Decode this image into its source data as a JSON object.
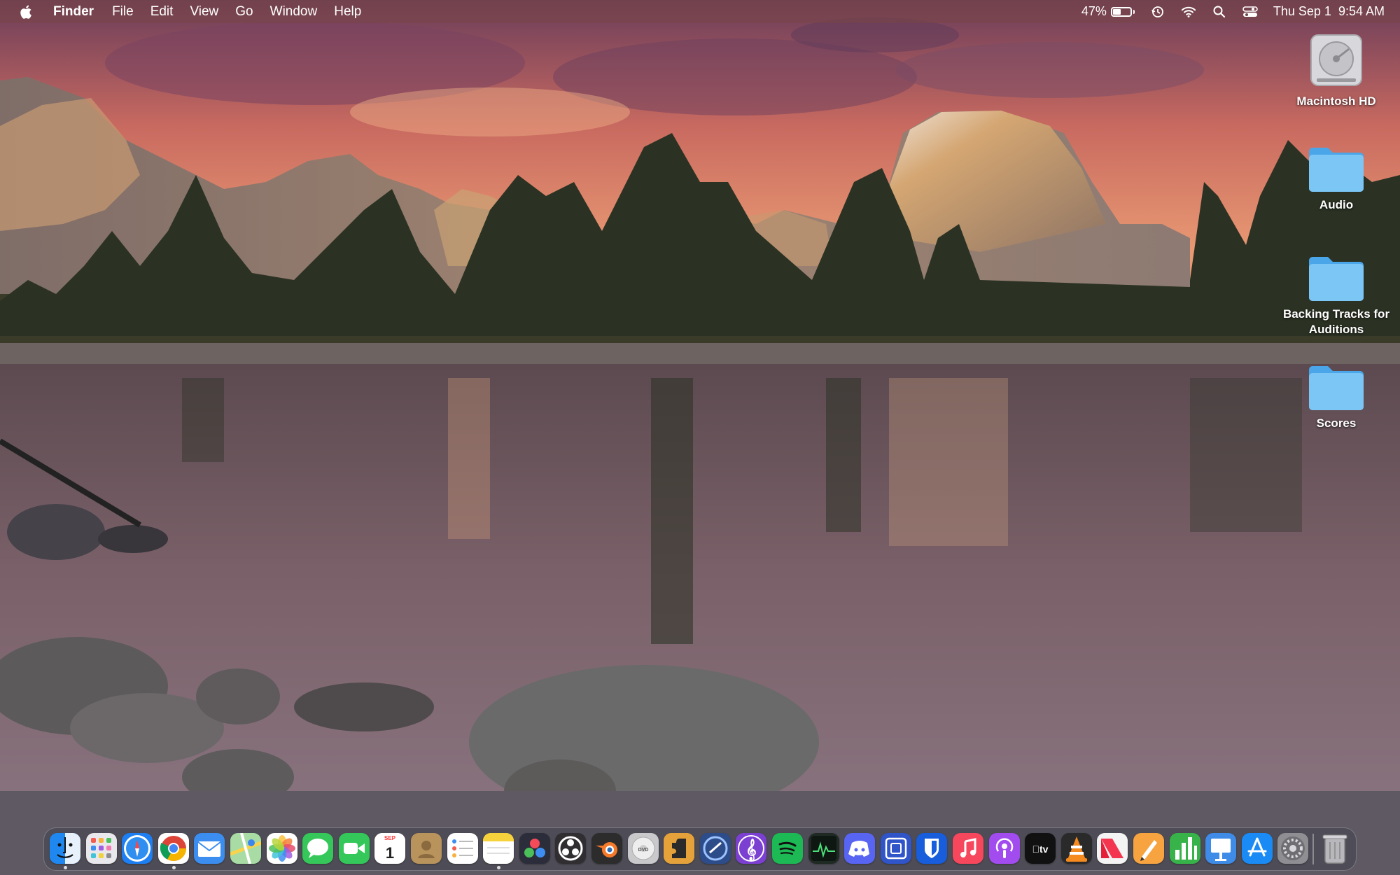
{
  "menubar": {
    "apple_icon": "apple-icon",
    "app_name": "Finder",
    "menus": [
      "File",
      "Edit",
      "View",
      "Go",
      "Window",
      "Help"
    ],
    "battery_percent": "47%",
    "battery_level": 0.47,
    "status_icons": [
      "time-machine-icon",
      "wifi-icon",
      "spotlight-search-icon",
      "control-center-icon"
    ],
    "clock": "Thu Sep 1  9:54 AM"
  },
  "desktop": {
    "icons": [
      {
        "label": "Macintosh HD",
        "icon": "hard-drive-icon"
      },
      {
        "label": "Audio",
        "icon": "folder-icon"
      },
      {
        "label": "Backing Tracks for Auditions",
        "icon": "folder-icon"
      },
      {
        "label": "Scores",
        "icon": "folder-icon"
      }
    ]
  },
  "dock": {
    "apps": [
      {
        "name": "finder",
        "color": "#2d8ff5",
        "running": true
      },
      {
        "name": "launchpad",
        "color": "#e8e8ec",
        "running": false
      },
      {
        "name": "safari",
        "color": "#1d7ff2",
        "running": false
      },
      {
        "name": "chrome",
        "color": "#ffffff",
        "running": true
      },
      {
        "name": "mail",
        "color": "#3b8ef0",
        "running": false
      },
      {
        "name": "maps",
        "color": "#6fc46f",
        "running": false
      },
      {
        "name": "photos",
        "color": "#ffffff",
        "running": false
      },
      {
        "name": "messages",
        "color": "#35c759",
        "running": false
      },
      {
        "name": "facetime",
        "color": "#34c759",
        "running": false
      },
      {
        "name": "calendar",
        "color": "#ffffff",
        "running": false,
        "month": "SEP",
        "day": "1"
      },
      {
        "name": "contacts",
        "color": "#b8935c",
        "running": false
      },
      {
        "name": "reminders",
        "color": "#ffffff",
        "running": false
      },
      {
        "name": "notes",
        "color": "#f6e27a",
        "running": true
      },
      {
        "name": "davinci-resolve",
        "color": "#2b2d3a",
        "running": false
      },
      {
        "name": "obs",
        "color": "#302e31",
        "running": false
      },
      {
        "name": "blender",
        "color": "#2c2c2c",
        "running": false
      },
      {
        "name": "dvd-player",
        "color": "#c9c9cc",
        "running": false
      },
      {
        "name": "jigsaw-puzzle-app",
        "color": "#e5a23a",
        "running": false
      },
      {
        "name": "screenflow",
        "color": "#2d4d8a",
        "running": false
      },
      {
        "name": "musescore",
        "color": "#7b3fd2",
        "running": false
      },
      {
        "name": "spotify",
        "color": "#1db954",
        "running": false
      },
      {
        "name": "activity-monitor",
        "color": "#1f2a24",
        "running": false
      },
      {
        "name": "discord",
        "color": "#5865f2",
        "running": false
      },
      {
        "name": "screen-capture-app",
        "color": "#2f55c8",
        "running": false
      },
      {
        "name": "bitwarden",
        "color": "#175ddc",
        "running": false
      },
      {
        "name": "music",
        "color": "#f6475d",
        "running": false
      },
      {
        "name": "podcasts",
        "color": "#a24cf0",
        "running": false
      },
      {
        "name": "apple-tv",
        "color": "#111111",
        "running": false
      },
      {
        "name": "vlc",
        "color": "#2a2a2a",
        "running": false
      },
      {
        "name": "news",
        "color": "#f4f4f4",
        "running": false
      },
      {
        "name": "pages",
        "color": "#f6a340",
        "running": false
      },
      {
        "name": "numbers",
        "color": "#37b34a",
        "running": false
      },
      {
        "name": "keynote",
        "color": "#3e8be8",
        "running": false
      },
      {
        "name": "app-store",
        "color": "#1a8bf5",
        "running": false
      },
      {
        "name": "system-preferences",
        "color": "#8e8e93",
        "running": false
      }
    ],
    "trash_icon": "trash-icon"
  }
}
